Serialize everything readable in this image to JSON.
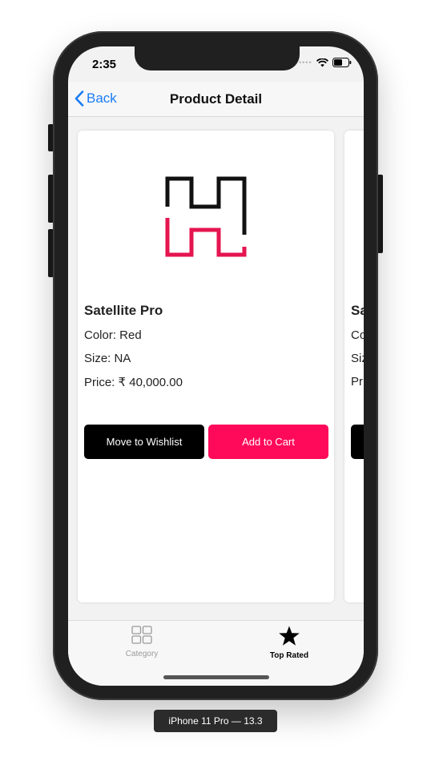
{
  "status": {
    "time": "2:35"
  },
  "navbar": {
    "back_label": "Back",
    "title": "Product Detail"
  },
  "products": [
    {
      "name": "Satellite Pro",
      "color": "Color: Red",
      "size": "Size: NA",
      "price": "Price: ₹ 40,000.00",
      "wishlist_label": "Move to Wishlist",
      "cart_label": "Add to Cart"
    },
    {
      "name_partial": "Sa",
      "color_partial": "Co",
      "size_partial": "Siz",
      "price_partial": "Pr"
    }
  ],
  "tabbar": {
    "items": [
      {
        "label": "Category",
        "icon": "grid-icon",
        "selected": false
      },
      {
        "label": "Top Rated",
        "icon": "star-icon",
        "selected": true
      }
    ]
  },
  "device_label": "iPhone 11 Pro — 13.3",
  "colors": {
    "accent": "#1a7cf5",
    "cart": "#ff0a5a",
    "wishlist": "#000000",
    "logo_dark": "#111111",
    "logo_pink": "#e5154f"
  }
}
